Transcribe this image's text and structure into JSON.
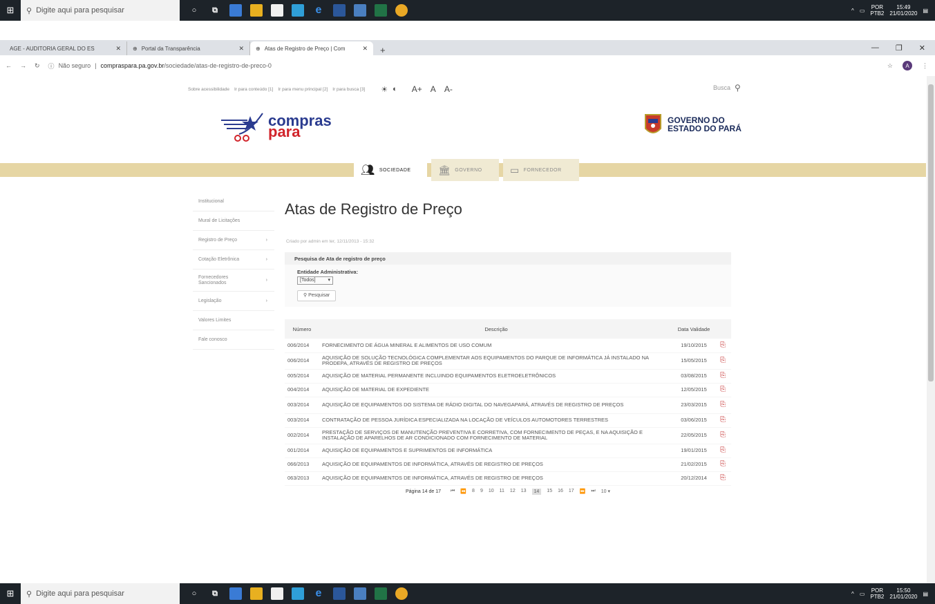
{
  "taskbar": {
    "search_placeholder": "Digite aqui para pesquisar",
    "top_lang": "POR",
    "top_lang2": "PTB2",
    "top_time": "15:49",
    "top_date": "21/01/2020",
    "bot_lang": "POR",
    "bot_lang2": "PTB2",
    "bot_time": "15:50",
    "bot_date": "21/01/2020"
  },
  "browser": {
    "tabs": [
      {
        "title": "AGE - AUDITORIA GERAL DO ES"
      },
      {
        "title": "Portal da Transparência"
      },
      {
        "title": "Atas de Registro de Preço | Com"
      }
    ],
    "not_secure": "Não seguro",
    "url_domain": "compraspara.pa.gov.br",
    "url_path": "/sociedade/atas-de-registro-de-preco-0",
    "avatar_letter": "A"
  },
  "header": {
    "access_links": [
      "Sobre acessibilidade",
      "Ir para conteúdo [1]",
      "Ir para menu principal [2]",
      "Ir para busca [3]"
    ],
    "font_sizes": [
      "A+",
      "A",
      "A-"
    ],
    "search_label": "Busca",
    "logo_line1": "compras",
    "logo_line2": "para",
    "gov_line1": "GOVERNO DO",
    "gov_line2": "ESTADO DO PARÁ"
  },
  "nav": {
    "sociedade": "SOCIEDADE",
    "governo": "GOVERNO",
    "fornecedor": "FORNECEDOR"
  },
  "sidebar": {
    "items": [
      {
        "label": "Institucional",
        "arrow": ""
      },
      {
        "label": "Mural de Licitações",
        "arrow": ""
      },
      {
        "label": "Registro de Preço",
        "arrow": "›"
      },
      {
        "label": "Cotação Eletrônica",
        "arrow": "›"
      },
      {
        "label": "Fornecedores Sancionados",
        "arrow": "›"
      },
      {
        "label": "Legislação",
        "arrow": "›"
      },
      {
        "label": "Valores Limites",
        "arrow": ""
      },
      {
        "label": "Fale conosco",
        "arrow": ""
      }
    ]
  },
  "main": {
    "title": "Atas de Registro de Preço",
    "updated": "Criado por admin em ter, 12/11/2013 - 15:32",
    "search_title": "Pesquisa de Ata de registro de preço",
    "entity_label": "Entidade Administrativa:",
    "entity_value": "[Todos]",
    "search_button": "Pesquisar",
    "table": {
      "col_numero": "Número",
      "col_descricao": "Descrição",
      "col_data": "Data Validade",
      "rows": [
        {
          "numero": "006/2014",
          "descricao": "FORNECIMENTO DE ÁGUA MINERAL E ALIMENTOS DE USO COMUM",
          "data": "19/10/2015"
        },
        {
          "numero": "006/2014",
          "descricao": "AQUISIÇÃO DE SOLUÇÃO TECNOLÓGICA COMPLEMENTAR AOS EQUIPAMENTOS DO PARQUE DE INFORMÁTICA JÁ INSTALADO NA PRODEPA, ATRAVÉS DE REGISTRO DE PREÇOS",
          "data": "15/05/2015"
        },
        {
          "numero": "005/2014",
          "descricao": "AQUISIÇÃO DE MATERIAL PERMANENTE INCLUINDO EQUIPAMENTOS ELETROELETRÔNICOS",
          "data": "03/08/2015"
        },
        {
          "numero": "004/2014",
          "descricao": "AQUISIÇÃO DE MATERIAL DE EXPEDIENTE",
          "data": "12/05/2015"
        },
        {
          "numero": "003/2014",
          "descricao": "AQUISIÇÃO DE EQUIPAMENTOS DO SISTEMA DE RÁDIO DIGITAL DO NAVEGAPARÁ, ATRAVÉS DE REGISTRO DE PREÇOS",
          "data": "23/03/2015"
        },
        {
          "numero": "003/2014",
          "descricao": "CONTRATAÇÃO DE PESSOA JURÍDICA ESPECIALIZADA NA LOCAÇÃO DE VEÍCULOS AUTOMOTORES TERRESTRES",
          "data": "03/06/2015"
        },
        {
          "numero": "002/2014",
          "descricao": "PRESTAÇÃO DE SERVIÇOS DE MANUTENÇÃO PREVENTIVA E CORRETIVA, COM FORNECIMENTO DE PEÇAS, E NA AQUISIÇÃO E INSTALAÇÃO DE APARELHOS DE AR CONDICIONADO COM FORNECIMENTO DE MATERIAL",
          "data": "22/05/2015"
        },
        {
          "numero": "001/2014",
          "descricao": "AQUISIÇÃO DE EQUIPAMENTOS E SUPRIMENTOS DE INFORMÁTICA",
          "data": "19/01/2015"
        },
        {
          "numero": "066/2013",
          "descricao": "AQUISIÇÃO DE EQUIPAMENTOS DE INFORMÁTICA, ATRAVÉS DE REGISTRO DE PREÇOS",
          "data": "21/02/2015"
        },
        {
          "numero": "063/2013",
          "descricao": "AQUISIÇÃO DE EQUIPAMENTOS DE INFORMÁTICA, ATRAVÉS DE REGISTRO DE PREÇOS",
          "data": "20/12/2014"
        }
      ]
    },
    "pager": {
      "info": "Página 14 de 17",
      "pages": [
        "8",
        "9",
        "10",
        "11",
        "12",
        "13",
        "14",
        "15",
        "16",
        "17"
      ],
      "current": "14",
      "page_size": "10"
    }
  }
}
